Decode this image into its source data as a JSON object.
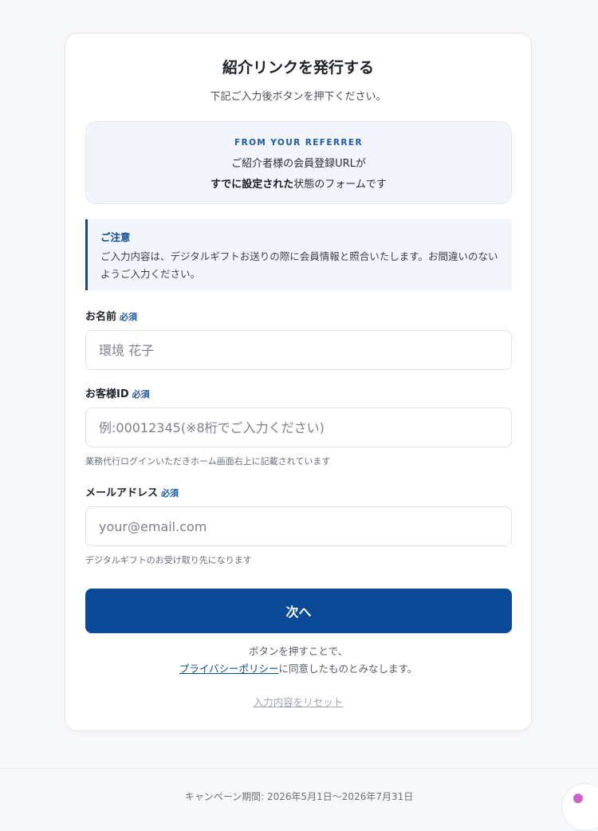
{
  "header": {
    "title": "紹介リンクを発行する",
    "subtitle": "下記ご入力後ボタンを押下ください。"
  },
  "referrer": {
    "eyebrow": "FROM YOUR REFERRER",
    "line1": "ご紹介者様の会員登録URLが",
    "line2_bold": "すでに設定された",
    "line2_rest": "状態のフォームです"
  },
  "notice": {
    "title": "ご注意",
    "body": "ご入力内容は、デジタルギフトお送りの際に会員情報と照合いたします。お間違いのないようご入力ください。"
  },
  "form": {
    "required_label": "必須",
    "name": {
      "label": "お名前",
      "placeholder": "環境 花子"
    },
    "customer_id": {
      "label": "お客様ID",
      "placeholder": "例:00012345(※8桁でご入力ください)",
      "hint": "業務代行ログインいただきホーム画面右上に記載されています"
    },
    "email": {
      "label": "メールアドレス",
      "placeholder": "your@email.com",
      "hint": "デジタルギフトのお受け取り先になります"
    },
    "submit_label": "次へ"
  },
  "consent": {
    "line1": "ボタンを押すことで、",
    "privacy_link": "プライバシーポリシー",
    "line2_rest": "に同意したものとみなします。"
  },
  "reset_label": "入力内容をリセット",
  "footer": {
    "campaign_period": "キャンペーン期間: 2026年5月1日〜2026年7月31日"
  },
  "colors": {
    "primary": "#0b4a96",
    "accent_text": "#1e5aa5"
  }
}
